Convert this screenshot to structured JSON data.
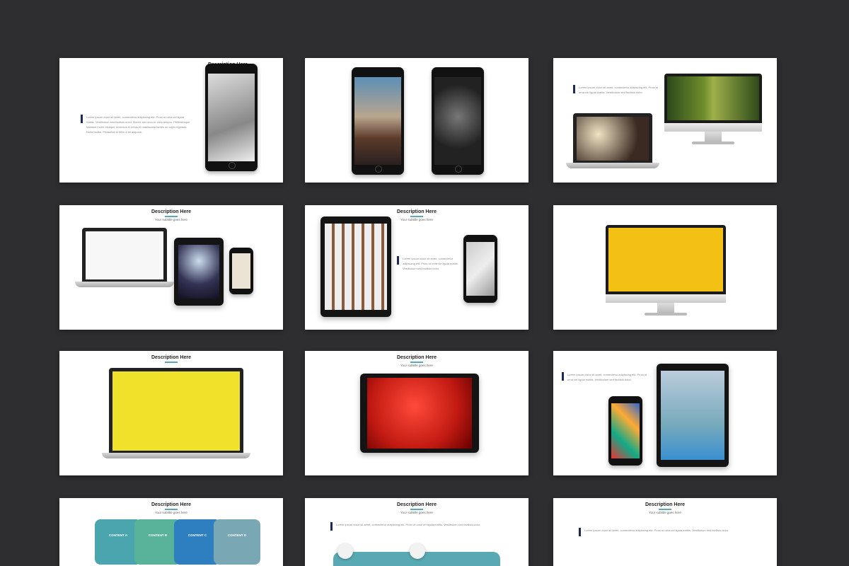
{
  "header": {
    "title": "Description Here",
    "subtitle": "Your subtitle goes here"
  },
  "body_text": {
    "paragraph": "Lorem ipsum dolor sit amet, consectetur adipiscing elit. Proin ut urna vel ligula mattis. Vestibulum sed facilisis dolor. Donec nec arcu et urna tempor. Pellentesque habitant morbi tristique senectus et netus et malesuada fames ac turpis egestas. Nulla facilisi. Phasellus in felis ut mi aliquam.",
    "short": "Lorem ipsum dolor sit amet, consectetur adipiscing elit. Proin ut urna vel ligula mattis. Vestibulum sed facilisis dolor."
  },
  "slide_content_tabs": [
    "CONTENT A",
    "CONTENT B",
    "CONTENT C",
    "CONTENT D"
  ],
  "colors": {
    "page_background": "#2e2e30",
    "accent_teal": "#5aa9b5",
    "marker_navy": "#1a2a5a",
    "yellow_screen": "#f3c114",
    "red_screen": "#e5241b"
  },
  "icons": [
    "phone-device-icon",
    "tablet-device-icon",
    "laptop-device-icon",
    "monitor-device-icon"
  ]
}
